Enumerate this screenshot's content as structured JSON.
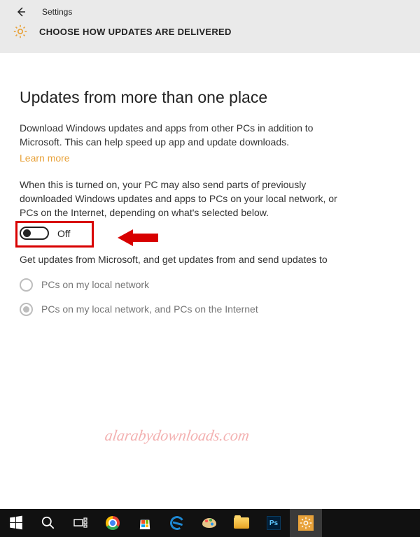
{
  "header": {
    "app_label": "Settings",
    "subtitle": "CHOOSE HOW UPDATES ARE DELIVERED"
  },
  "content": {
    "heading": "Updates from more than one place",
    "paragraph1": "Download Windows updates and apps from other PCs in addition to Microsoft. This can help speed up app and update downloads.",
    "learn_more": "Learn more",
    "paragraph2": "When this is turned on, your PC may also send parts of previously downloaded Windows updates and apps to PCs on your local network, or PCs on the Internet, depending on what's selected below.",
    "toggle_label": "Off",
    "paragraph3": "Get updates from Microsoft, and get updates from and send updates to",
    "radio_options": [
      "PCs on my local network",
      "PCs on my local network, and PCs on the Internet"
    ]
  },
  "watermark": "alarabydownloads.com",
  "taskbar": {
    "items": [
      "start",
      "search",
      "task-view",
      "chrome",
      "store",
      "edge",
      "paint",
      "file-explorer",
      "photoshop",
      "settings"
    ]
  },
  "colors": {
    "accent": "#e8a23a",
    "highlight": "#d80000"
  }
}
